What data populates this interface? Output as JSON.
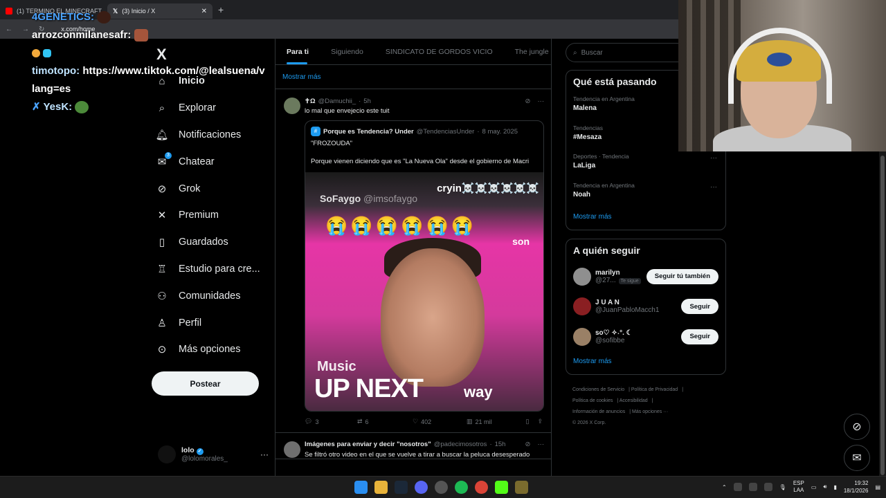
{
  "browser": {
    "tabs": [
      {
        "label": "(1) TERMINO EL MINECRAFT",
        "active": false
      },
      {
        "label": "(3) Inicio / X",
        "active": true
      }
    ],
    "url": "x.com/home"
  },
  "chat": [
    {
      "user": "4GENETICS:",
      "message": ""
    },
    {
      "user": "arrozconmilanesafr:",
      "message": ""
    },
    {
      "user": "",
      "message": ""
    },
    {
      "user": "timotopo:",
      "message": "https://www.tiktok.com/@lealsuena/v"
    },
    {
      "user": "",
      "message": "lang=es"
    },
    {
      "user": "YesK:",
      "message": ""
    }
  ],
  "sidebar": {
    "logo": "X",
    "items": [
      {
        "label": "Inicio",
        "icon": "home-icon"
      },
      {
        "label": "Explorar",
        "icon": "search-icon"
      },
      {
        "label": "Notificaciones",
        "icon": "bell-icon"
      },
      {
        "label": "Chatear",
        "icon": "mail-icon",
        "badge": "3"
      },
      {
        "label": "Grok",
        "icon": "grok-icon"
      },
      {
        "label": "Premium",
        "icon": "x-icon"
      },
      {
        "label": "Guardados",
        "icon": "bookmark-icon"
      },
      {
        "label": "Estudio para cre...",
        "icon": "studio-icon"
      },
      {
        "label": "Comunidades",
        "icon": "people-icon"
      },
      {
        "label": "Perfil",
        "icon": "person-icon"
      },
      {
        "label": "Más opciones",
        "icon": "more-circle-icon"
      }
    ],
    "post_button": "Postear",
    "profile": {
      "name": "lolo",
      "handle": "@lolomorales_"
    }
  },
  "feed": {
    "tabs": [
      "Para ti",
      "Siguiendo",
      "SINDICATO DE GORDOS VICIO",
      "The jungle"
    ],
    "show_more": "Mostrar más",
    "tweets": [
      {
        "name": "✝Ω",
        "handle": "@Damuchii_",
        "time": "5h",
        "text": "lo mal que envejecio este tuit",
        "quote": {
          "name": "Porque es Tendencia? Under",
          "handle": "@TendenciasUnder",
          "date": "8 may. 2025",
          "line1": "\"FROZOUDA\"",
          "line2": "Porque vienen diciendo que es \"La Nueva Ola\" desde el gobierno de Macri"
        },
        "media": {
          "sofaygo": "SoFaygo",
          "sofaygo_handle": "@imsofaygo",
          "cryin": "cryin☠️☠️☠️☠️☠️☠️",
          "son": "son",
          "music": "Music",
          "upnext": "UP NEXT",
          "way": "way"
        },
        "stats": {
          "replies": "3",
          "reposts": "6",
          "likes": "402",
          "views": "21 mil"
        }
      },
      {
        "name": "Imágenes para enviar y decir \"nosotros\"",
        "handle": "@padecimosotros",
        "time": "15h",
        "text": "Se filtró otro video en el que se vuelve a tirar a buscar la peluca desesperado"
      }
    ]
  },
  "search": {
    "placeholder": "Buscar"
  },
  "trends": {
    "title": "Qué está pasando",
    "items": [
      {
        "context": "Tendencia en Argentina",
        "name": "Malena"
      },
      {
        "context": "Tendencias",
        "name": "#Mesaza"
      },
      {
        "context": "Deportes · Tendencia",
        "name": "LaLiga"
      },
      {
        "context": "Tendencia en Argentina",
        "name": "Noah"
      }
    ],
    "show_more": "Mostrar más"
  },
  "who_to_follow": {
    "title": "A quién seguir",
    "items": [
      {
        "name": "marilyn",
        "handle": "@27...",
        "tag": "Te sigue",
        "button": "Seguir tú también"
      },
      {
        "name": "J U A N",
        "handle": "@JuanPabloMacch1",
        "button": "Seguir"
      },
      {
        "name": "so♡ ✧˖°. ☾",
        "handle": "@sofibbe",
        "button": "Seguir"
      }
    ],
    "show_more": "Mostrar más"
  },
  "footer": {
    "links": [
      "Condiciones de Servicio",
      "Política de Privacidad",
      "Política de cookies",
      "Accesibilidad",
      "Información de anuncios",
      "Más opciones ···"
    ],
    "copyright": "© 2026 X Corp."
  },
  "taskbar": {
    "lang_top": "ESP",
    "lang_bottom": "LAA",
    "time": "19:32",
    "date": "18/1/2026"
  },
  "colors": {
    "accent": "#1d9bf0",
    "background": "#000000",
    "border": "#2f3336"
  }
}
